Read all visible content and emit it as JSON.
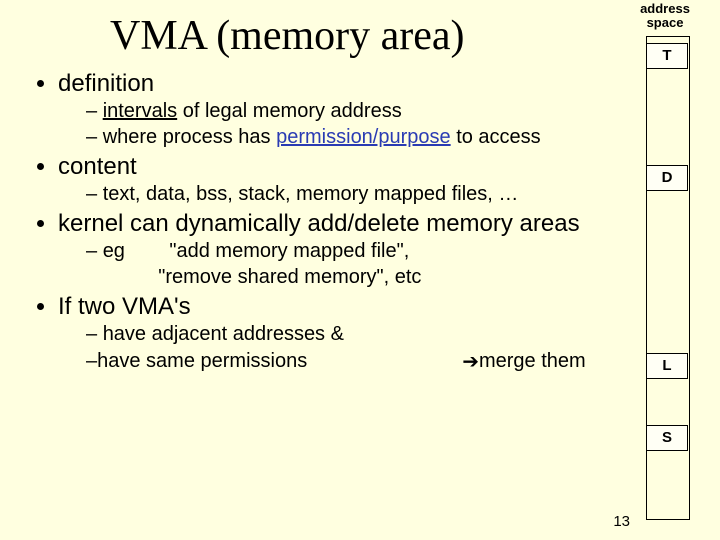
{
  "title": "VMA (memory area)",
  "bullets": {
    "definition": "definition",
    "def_sub1_a": "intervals",
    "def_sub1_b": " of legal memory address",
    "def_sub2_a": "where process has ",
    "def_sub2_b": "permission/purpose",
    "def_sub2_c": " to access",
    "content": "content",
    "content_sub1": "text, data, bss, stack, memory mapped files, …",
    "kernel": "kernel can dynamically add/delete memory areas",
    "kernel_sub_eg": "eg",
    "kernel_sub_q1": "\"add memory mapped file\",",
    "kernel_sub_q2": "\"remove shared memory\", etc",
    "iftwo": "If two VMA's",
    "iftwo_sub1": "have adjacent addresses &",
    "iftwo_sub2": "have same permissions",
    "arrow": "➔",
    "merge": "  merge them"
  },
  "diagram": {
    "header": "address space",
    "t": "T",
    "d": "D",
    "l": "L",
    "s": "S"
  },
  "page_number": "13"
}
